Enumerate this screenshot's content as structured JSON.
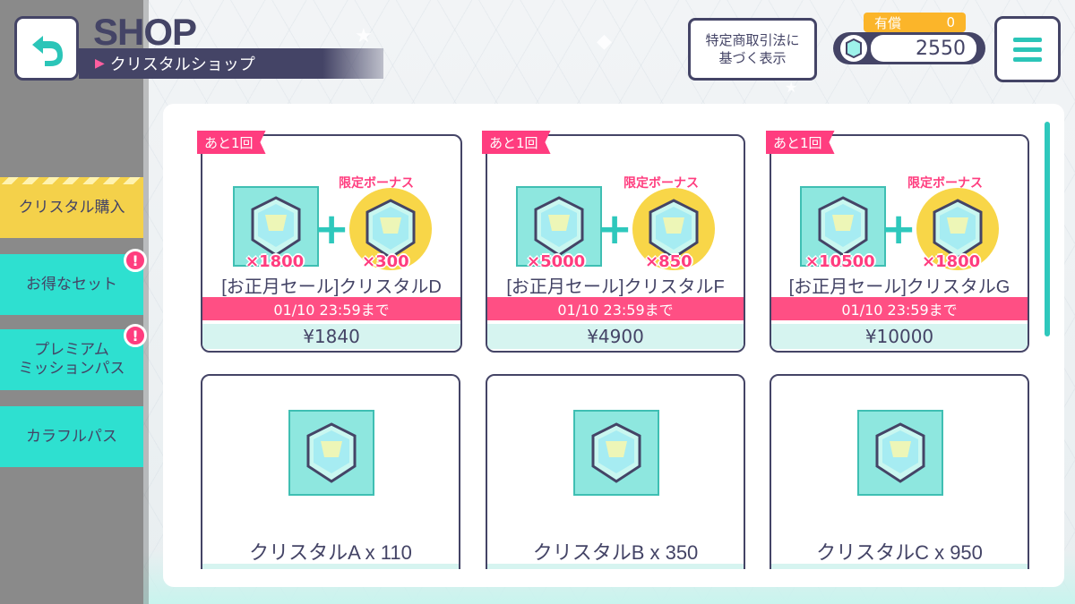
{
  "header": {
    "title": "SHOP",
    "subtitle": "クリスタルショップ",
    "law_button_line1": "特定商取引法に",
    "law_button_line2": "基づく表示"
  },
  "wallet": {
    "paid_label": "有償",
    "paid_value": "0",
    "crystal_amount": "2550"
  },
  "sidebar": {
    "items": [
      {
        "label": "クリスタル購入",
        "active": true,
        "alert": false
      },
      {
        "label": "お得なセット",
        "active": false,
        "alert": true,
        "alert_text": "!"
      },
      {
        "label_line1": "プレミアム",
        "label_line2": "ミッションパス",
        "active": false,
        "alert": true,
        "alert_text": "!"
      },
      {
        "label": "カラフルパス",
        "active": false,
        "alert": false
      }
    ]
  },
  "sale_cards": [
    {
      "remaining": "あと1回",
      "bonus_label": "限定ボーナス",
      "base_qty": "×1800",
      "bonus_qty": "×300",
      "name": "[お正月セール]クリスタルD",
      "deadline": "01/10 23:59まで",
      "price": "¥1840"
    },
    {
      "remaining": "あと1回",
      "bonus_label": "限定ボーナス",
      "base_qty": "×5000",
      "bonus_qty": "×850",
      "name": "[お正月セール]クリスタルF",
      "deadline": "01/10 23:59まで",
      "price": "¥4900"
    },
    {
      "remaining": "あと1回",
      "bonus_label": "限定ボーナス",
      "base_qty": "×10500",
      "bonus_qty": "×1800",
      "name": "[お正月セール]クリスタルG",
      "deadline": "01/10 23:59まで",
      "price": "¥10000"
    }
  ],
  "plain_cards": [
    {
      "name": "クリスタルA x 110"
    },
    {
      "name": "クリスタルB x 350"
    },
    {
      "name": "クリスタルC x 950"
    }
  ],
  "icons": {
    "back": "back-arrow-icon",
    "menu": "hamburger-menu-icon",
    "crystal": "crystal-icon"
  },
  "colors": {
    "accent_teal": "#2ee0d0",
    "accent_pink": "#ff3d7f",
    "accent_yellow": "#f4d14a",
    "ink": "#444466"
  }
}
